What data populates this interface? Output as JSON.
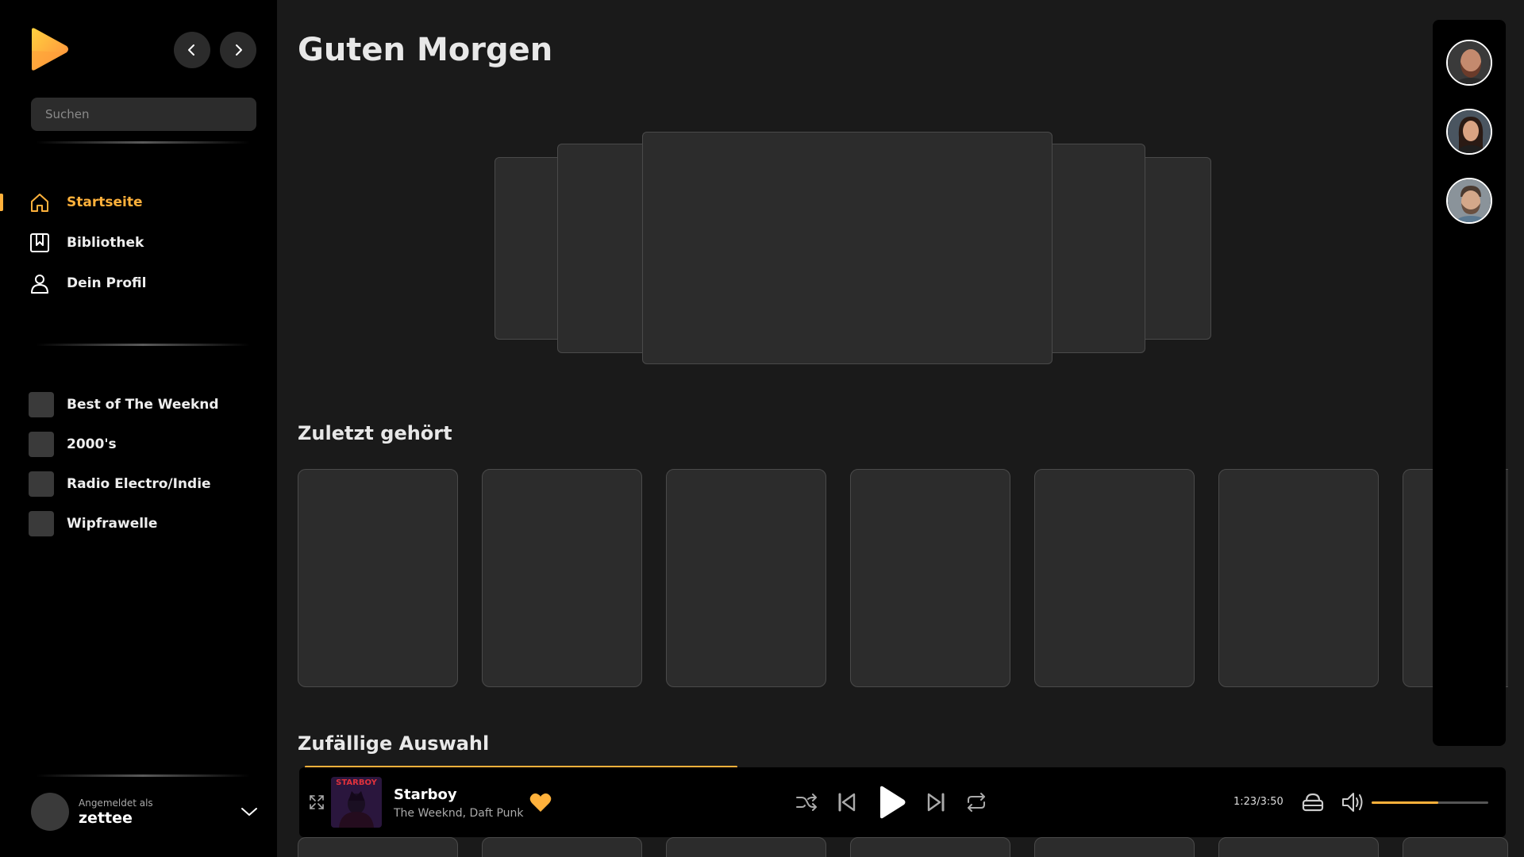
{
  "header": {
    "title": "Guten Morgen"
  },
  "search": {
    "placeholder": "Suchen"
  },
  "nav": {
    "items": [
      {
        "label": "Startseite",
        "active": true
      },
      {
        "label": "Bibliothek",
        "active": false
      },
      {
        "label": "Dein Profil",
        "active": false
      }
    ]
  },
  "playlists": [
    {
      "label": "Best of The Weeknd"
    },
    {
      "label": "2000's"
    },
    {
      "label": "Radio Electro/Indie"
    },
    {
      "label": "Wipfrawelle"
    }
  ],
  "user": {
    "caption": "Angemeldet als",
    "name": "zettee"
  },
  "sections": {
    "recent": "Zuletzt gehört",
    "random": "Zufällige Auswahl"
  },
  "player": {
    "title": "Starboy",
    "artist": "The Weeknd, Daft Punk",
    "cover_text": "STARBOY",
    "time": "1:23/3:50",
    "progress": 0.36,
    "volume": 0.57,
    "liked": true
  },
  "colors": {
    "accent": "#ffb13b",
    "sidebar": "#000000",
    "background": "#1a1a1a",
    "card": "#2c2c2c"
  }
}
